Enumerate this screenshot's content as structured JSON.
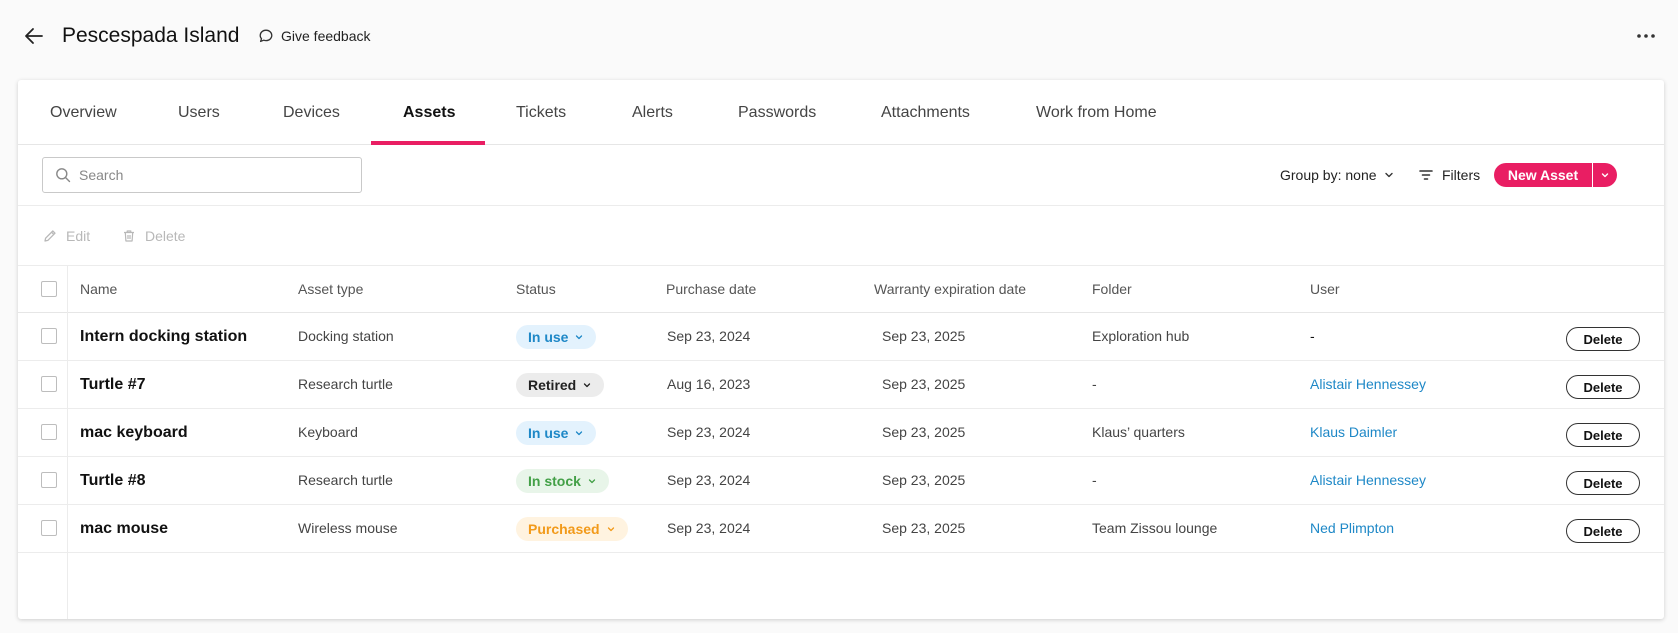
{
  "header": {
    "title": "Pescespada Island",
    "feedback_label": "Give feedback"
  },
  "tabs": [
    {
      "label": "Overview"
    },
    {
      "label": "Users"
    },
    {
      "label": "Devices"
    },
    {
      "label": "Assets",
      "active": true
    },
    {
      "label": "Tickets"
    },
    {
      "label": "Alerts"
    },
    {
      "label": "Passwords"
    },
    {
      "label": "Attachments"
    },
    {
      "label": "Work from Home"
    }
  ],
  "toolbar": {
    "search_placeholder": "Search",
    "group_by_label": "Group by: none",
    "filters_label": "Filters",
    "new_asset_label": "New Asset"
  },
  "actions": {
    "edit_label": "Edit",
    "delete_label": "Delete"
  },
  "table": {
    "columns": [
      "Name",
      "Asset type",
      "Status",
      "Purchase date",
      "Warranty expiration date",
      "Folder",
      "User"
    ],
    "delete_label": "Delete",
    "rows": [
      {
        "name": "Intern docking station",
        "asset_type": "Docking station",
        "status": "In use",
        "status_kind": "inuse",
        "purchase_date": "Sep 23, 2024",
        "warranty": "Sep 23, 2025",
        "folder": "Exploration hub",
        "user": "-"
      },
      {
        "name": "Turtle #7",
        "asset_type": "Research turtle",
        "status": "Retired",
        "status_kind": "retired",
        "purchase_date": "Aug 16, 2023",
        "warranty": "Sep 23, 2025",
        "folder": "-",
        "user": "Alistair Hennessey"
      },
      {
        "name": "mac keyboard",
        "asset_type": "Keyboard",
        "status": "In use",
        "status_kind": "inuse",
        "purchase_date": "Sep 23, 2024",
        "warranty": "Sep 23, 2025",
        "folder": "Klaus’ quarters",
        "user": "Klaus Daimler"
      },
      {
        "name": "Turtle #8",
        "asset_type": "Research turtle",
        "status": "In stock",
        "status_kind": "instock",
        "purchase_date": "Sep 23, 2024",
        "warranty": "Sep 23, 2025",
        "folder": "-",
        "user": "Alistair Hennessey"
      },
      {
        "name": "mac mouse",
        "asset_type": "Wireless mouse",
        "status": "Purchased",
        "status_kind": "purchased",
        "purchase_date": "Sep 23, 2024",
        "warranty": "Sep 23, 2025",
        "folder": "Team Zissou lounge",
        "user": "Ned Plimpton"
      }
    ]
  },
  "colors": {
    "accent": "#e91e63",
    "link": "#1e88c7",
    "status_inuse": "#1e88c7",
    "status_instock": "#43a047",
    "status_purchased": "#f29a1a"
  }
}
